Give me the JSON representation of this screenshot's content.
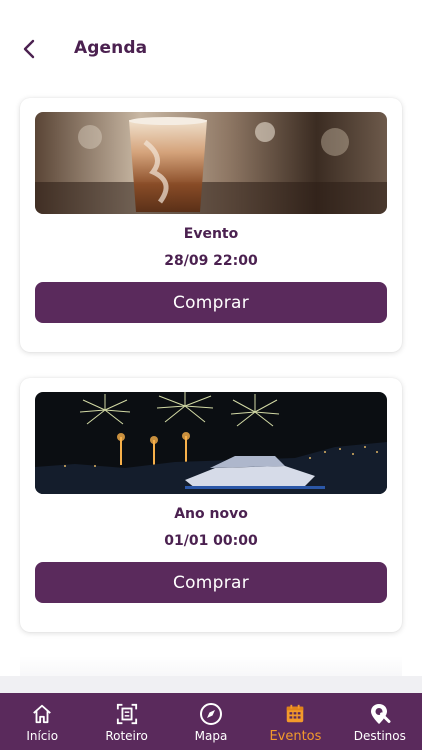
{
  "header": {
    "title": "Agenda",
    "back_icon": "chevron-left-icon"
  },
  "events": [
    {
      "title": "Evento",
      "date": "28/09 22:00",
      "button_label": "Comprar",
      "image": "iced-coffee-photo"
    },
    {
      "title": "Ano novo",
      "date": "01/01 00:00",
      "button_label": "Comprar",
      "image": "fireworks-yacht-photo"
    }
  ],
  "tabbar": {
    "items": [
      {
        "label": "Início",
        "icon": "home-icon",
        "active": false
      },
      {
        "label": "Roteiro",
        "icon": "itinerary-icon",
        "active": false
      },
      {
        "label": "Mapa",
        "icon": "compass-icon",
        "active": false
      },
      {
        "label": "Eventos",
        "icon": "calendar-icon",
        "active": true
      },
      {
        "label": "Destinos",
        "icon": "search-location-icon",
        "active": false
      }
    ]
  },
  "colors": {
    "primary": "#5a2a5c",
    "accent": "#f39a2b",
    "text": "#4b2150",
    "background": "#ffffff"
  }
}
